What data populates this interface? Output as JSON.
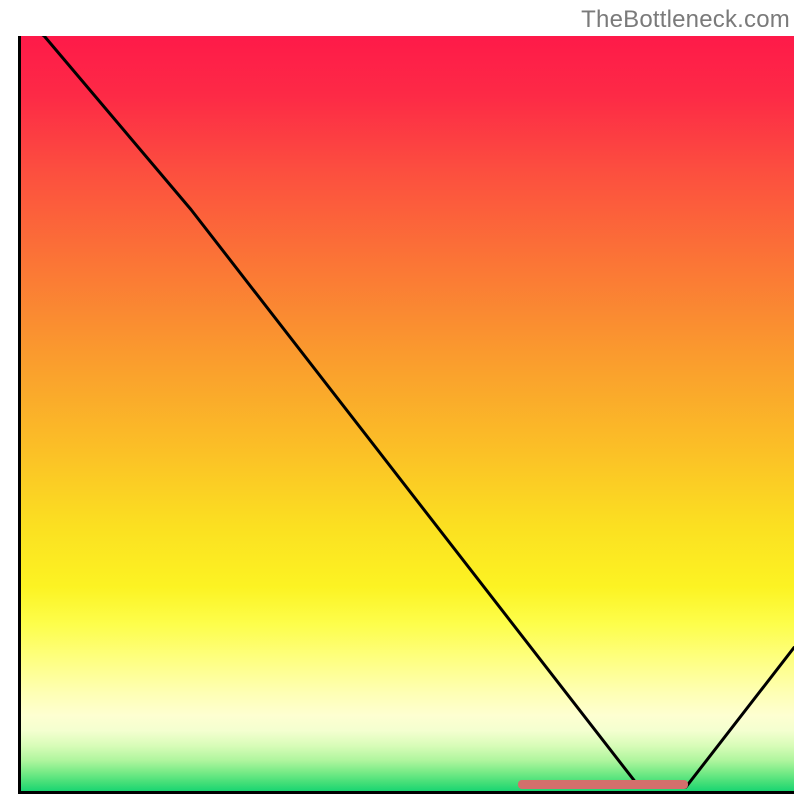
{
  "watermark": "TheBottleneck.com",
  "chart_data": {
    "type": "line",
    "title": "",
    "xlabel": "",
    "ylabel": "",
    "xlim": [
      0,
      100
    ],
    "ylim": [
      0,
      100
    ],
    "x": [
      0,
      3,
      22,
      80,
      86,
      100
    ],
    "values": [
      102,
      100,
      77,
      0.5,
      0.5,
      19
    ],
    "background_gradient": {
      "direction": "vertical",
      "stops": [
        {
          "pos": 0.0,
          "color": "#fe1a49"
        },
        {
          "pos": 0.4,
          "color": "#fa9a2e"
        },
        {
          "pos": 0.7,
          "color": "#fcf228"
        },
        {
          "pos": 0.88,
          "color": "#feffc8"
        },
        {
          "pos": 0.96,
          "color": "#91f192"
        },
        {
          "pos": 1.0,
          "color": "#1ad572"
        }
      ]
    },
    "bottom_marker": {
      "x_start": 64,
      "x_end": 86,
      "color": "#d36f6c"
    }
  }
}
